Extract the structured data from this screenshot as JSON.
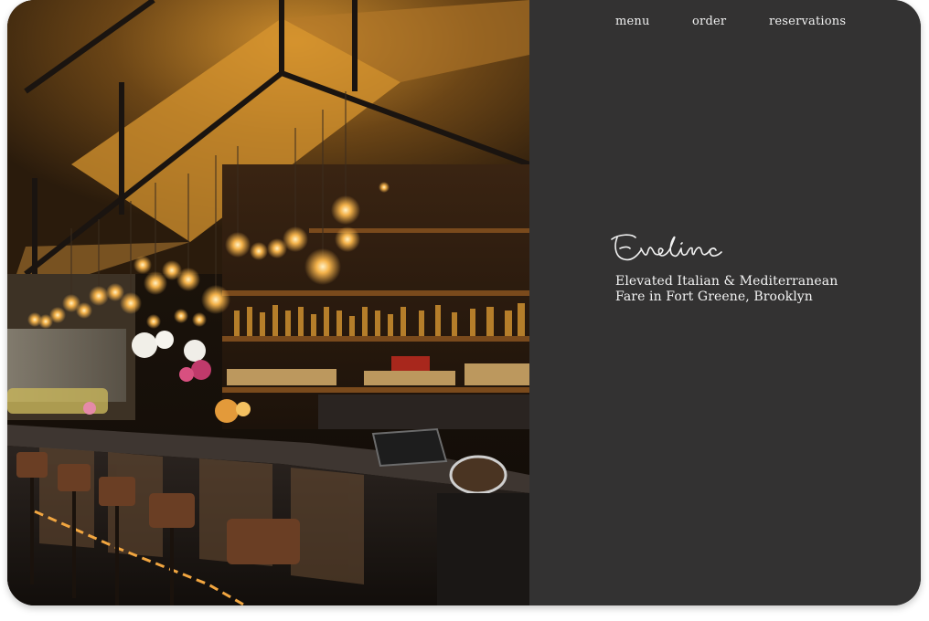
{
  "nav": {
    "items": [
      {
        "label": "menu"
      },
      {
        "label": "order"
      },
      {
        "label": "reservations"
      }
    ]
  },
  "brand": {
    "logo_text": "Evelina",
    "tagline_line1": "Elevated Italian & Mediterranean",
    "tagline_line2": "Fare in Fort Greene, Brooklyn"
  },
  "hero": {
    "image": "restaurant-bar-interior-photo"
  },
  "colors": {
    "panel_background": "#333232",
    "text": "#f1f1f1",
    "warm_light": "#f4b24a"
  }
}
